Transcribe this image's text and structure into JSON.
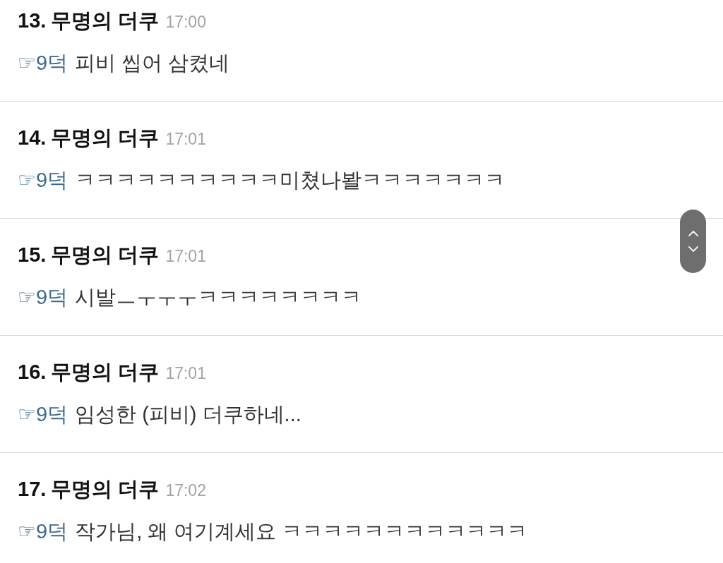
{
  "comments": [
    {
      "number": "13.",
      "author": "무명의 더쿠",
      "time": "17:00",
      "reply_to": "☞9덕",
      "text": "피비 씹어 삼켰네"
    },
    {
      "number": "14.",
      "author": "무명의 더쿠",
      "time": "17:01",
      "reply_to": "☞9덕",
      "text": "ㅋㅋㅋㅋㅋㅋㅋㅋㅋㅋ미쳤나봘ㅋㅋㅋㅋㅋㅋㅋ"
    },
    {
      "number": "15.",
      "author": "무명의 더쿠",
      "time": "17:01",
      "reply_to": "☞9덕",
      "text": "시발ㅡㅜㅜㅜㅋㅋㅋㅋㅋㅋㅋㅋ"
    },
    {
      "number": "16.",
      "author": "무명의 더쿠",
      "time": "17:01",
      "reply_to": "☞9덕",
      "text": "임성한 (피비) 더쿠하네..."
    },
    {
      "number": "17.",
      "author": "무명의 더쿠",
      "time": "17:02",
      "reply_to": "☞9덕",
      "text": "작가님, 왜 여기계세요 ㅋㅋㅋㅋㅋㅋㅋㅋㅋㅋㅋㅋ"
    }
  ]
}
